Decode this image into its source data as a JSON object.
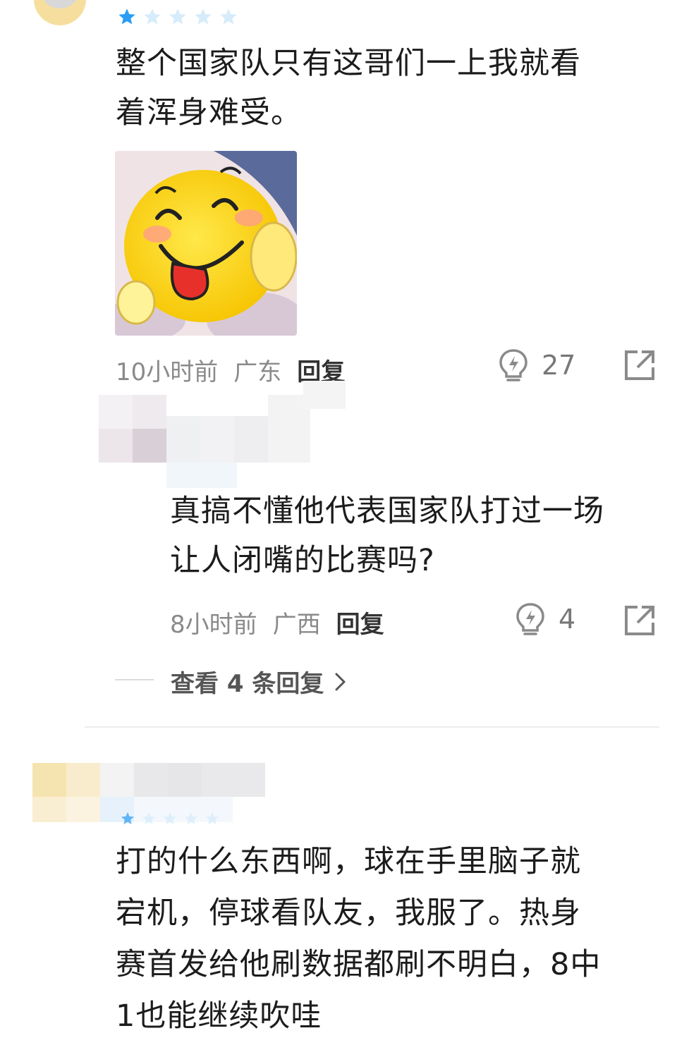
{
  "comment1": {
    "rating": 1,
    "rating_max": 5,
    "text_line1": "整个国家队只有这哥们一上我就看",
    "text_line2": "着浑身难受。",
    "image_icon": "laughing-tongue-emoji-sticker",
    "time": "10小时前",
    "location": "广东",
    "reply_label": "回复",
    "likes": "27"
  },
  "reply1": {
    "text_line1": "真搞不懂他代表国家队打过一场",
    "text_line2": "让人闭嘴的比赛吗?",
    "time": "8小时前",
    "location": "广西",
    "reply_label": "回复",
    "likes": "4"
  },
  "view_replies": {
    "label": "查看 4 条回复"
  },
  "comment2": {
    "rating": 1,
    "rating_max": 5,
    "text_line1": "打的什么东西啊，球在手里脑子就",
    "text_line2": "宕机，停球看队友，我服了。热身",
    "text_line3": "赛首发给他刷数据都刷不明白，8中",
    "text_line4": "1也能继续吹哇"
  },
  "colors": {
    "star_active": "#2a9df4",
    "star_inactive": "#d6ecfb",
    "meta_gray": "#8a8a8a"
  }
}
